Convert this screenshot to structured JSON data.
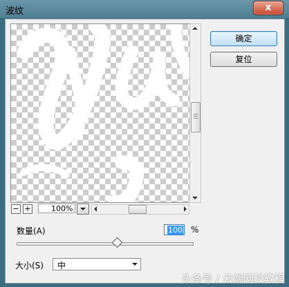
{
  "window": {
    "title": "波纹",
    "close_glyph": "x"
  },
  "preview": {
    "zoom_value": "100%",
    "zoom_out_glyph": "−",
    "zoom_in_glyph": "+"
  },
  "buttons": {
    "ok_label": "确定",
    "reset_label": "复位"
  },
  "amount": {
    "label": "数量(A)",
    "value": "100",
    "unit": "%",
    "slider_fraction": 0.57
  },
  "size": {
    "label": "大小(S)",
    "selected": "中"
  },
  "watermark": "头条号 / 云端网校教程"
}
